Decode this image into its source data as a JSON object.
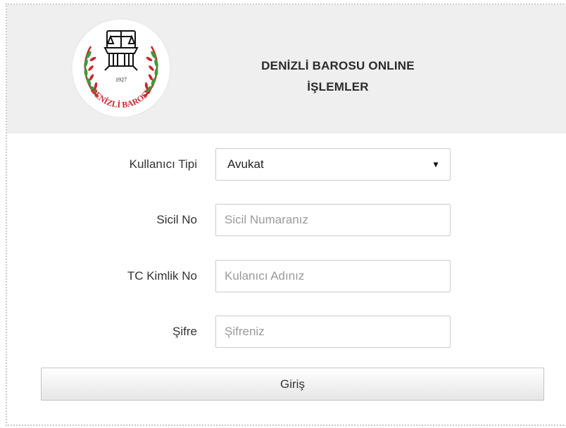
{
  "header": {
    "title_line1": "DENİZLİ BAROSU ONLINE",
    "title_line2": "İŞLEMLER",
    "logo": {
      "year": "1927",
      "name": "DENİZLİ BAROSU",
      "icon": "scales-of-justice-emblem",
      "colors": {
        "ring_outer": "#c8282e",
        "laurel_green": "#3e9a3a",
        "text_red": "#c8282e",
        "scales": "#111111"
      }
    }
  },
  "form": {
    "user_type": {
      "label": "Kullanıcı Tipi",
      "selected": "Avukat",
      "arrow_icon": "caret-down-icon"
    },
    "registry_no": {
      "label": "Sicil No",
      "value": "",
      "placeholder": "Sicil Numaranız"
    },
    "tc_id": {
      "label": "TC Kimlik No",
      "value": "",
      "placeholder": "Kulanıcı Adınız"
    },
    "password": {
      "label": "Şifre",
      "value": "",
      "placeholder": "Şifreniz"
    },
    "submit_label": "Giriş"
  },
  "colors": {
    "header_bg": "#efefef",
    "border": "#cccccc",
    "text": "#333333"
  }
}
